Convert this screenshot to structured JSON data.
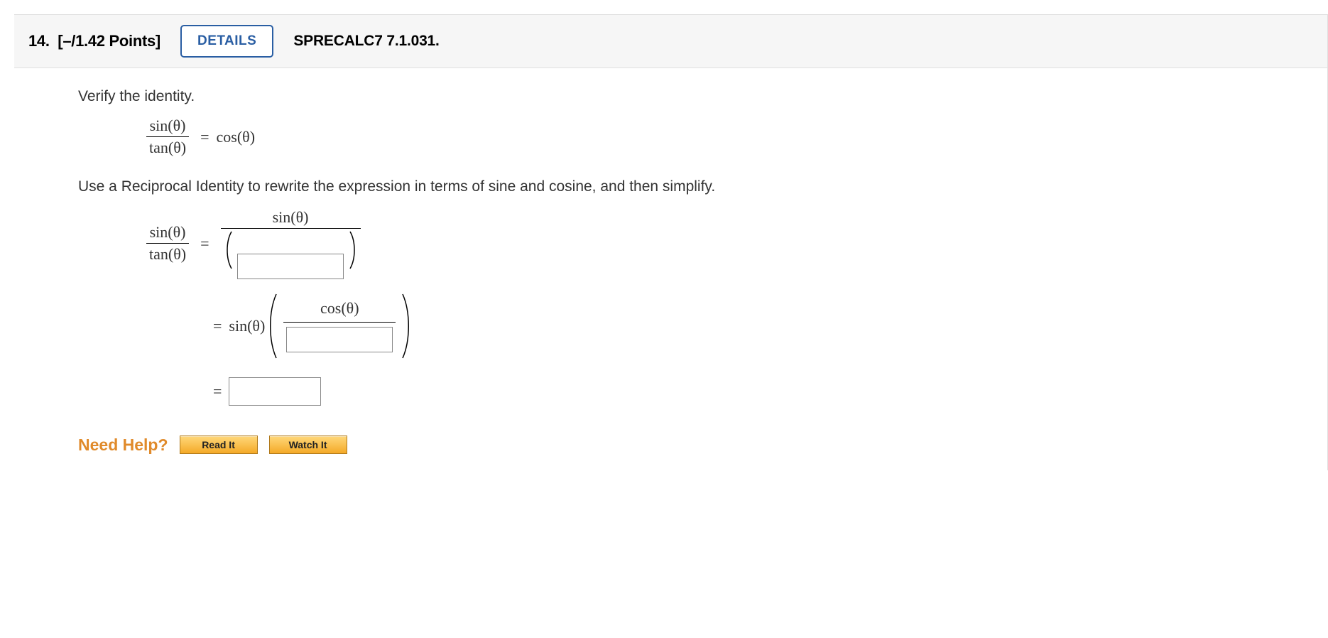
{
  "header": {
    "number_points": "14.  [–/1.42 Points]",
    "details_label": "DETAILS",
    "reference": "SPRECALC7 7.1.031."
  },
  "content": {
    "instruction": "Verify the identity.",
    "identity": {
      "lhs_num": "sin(θ)",
      "lhs_den": "tan(θ)",
      "rhs": "cos(θ)"
    },
    "sub_instruction": "Use a Reciprocal Identity to rewrite the expression in terms of sine and cosine, and then simplify.",
    "step1": {
      "lhs_num": "sin(θ)",
      "lhs_den": "tan(θ)",
      "rhs_num": "sin(θ)"
    },
    "step2": {
      "prefix": "sin(θ)",
      "inner_num": "cos(θ)"
    },
    "equals": "="
  },
  "help": {
    "label": "Need Help?",
    "read": "Read It",
    "watch": "Watch It"
  }
}
